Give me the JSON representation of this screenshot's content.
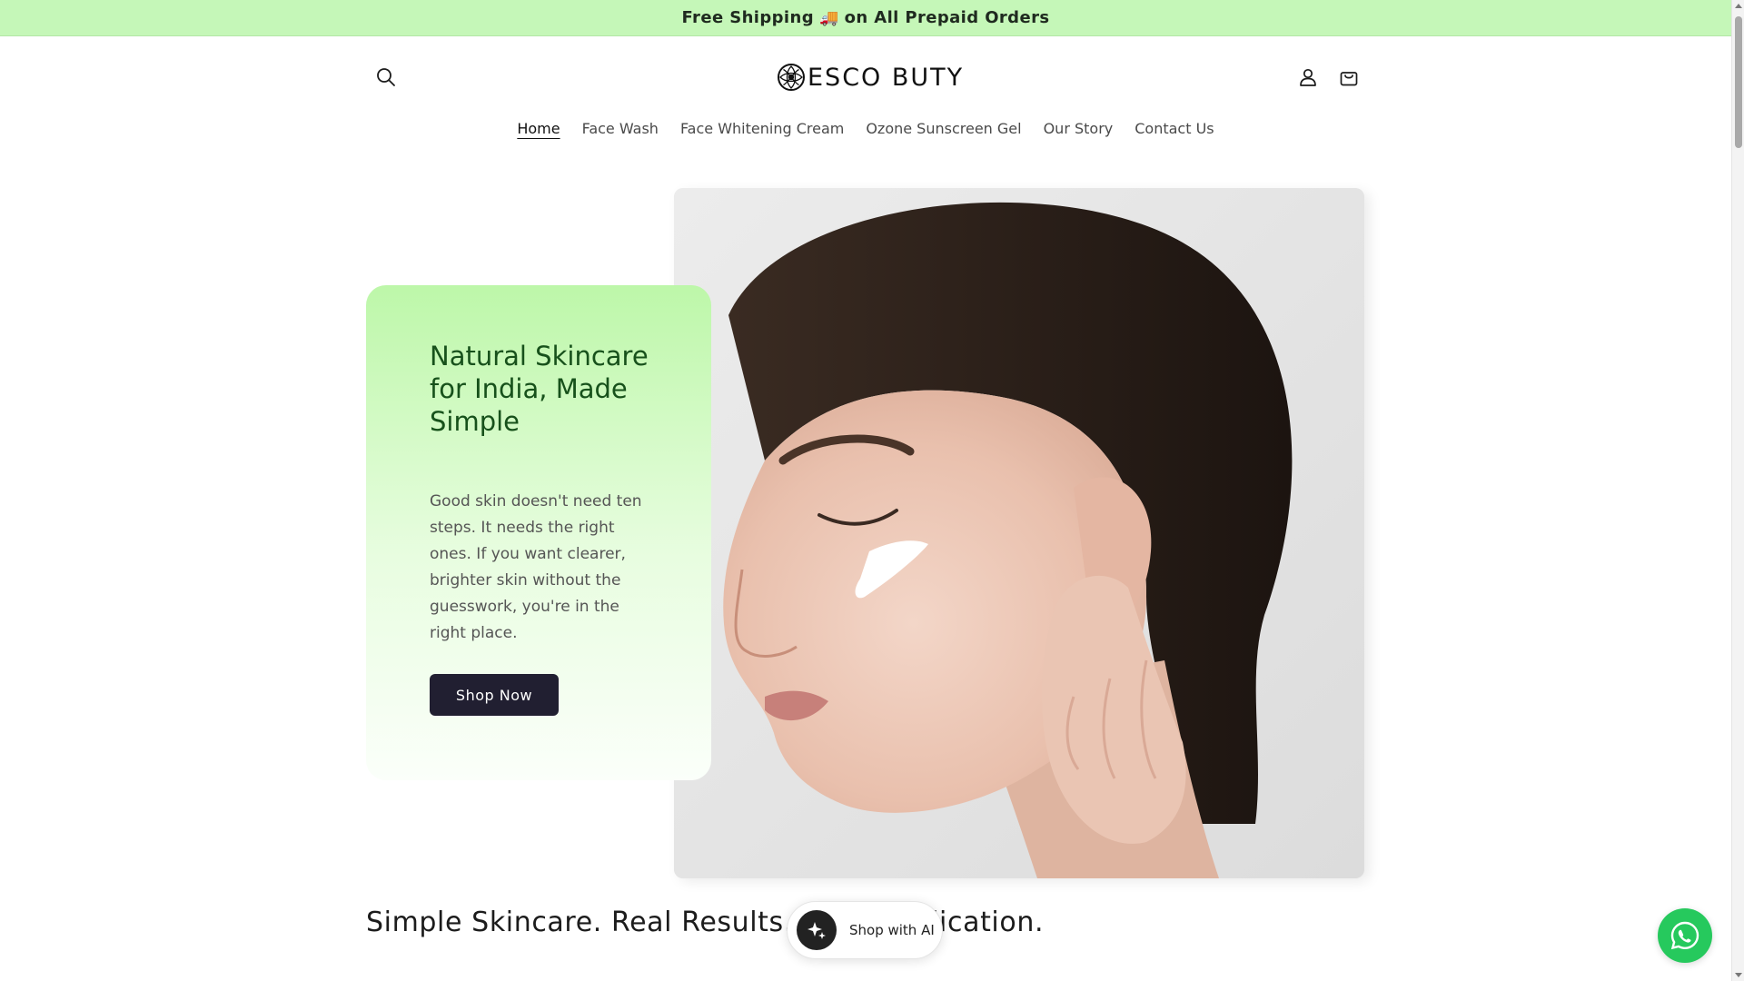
{
  "announcement": {
    "text_before": "Free Shipping",
    "truck_icon": "🚚",
    "text_after": "on All Prepaid Orders",
    "background_color": "#c5f7b8"
  },
  "header": {
    "logo_text": "ESCO BUTY",
    "icons": {
      "search": "search-icon",
      "account": "account-icon",
      "cart": "cart-icon"
    }
  },
  "nav": {
    "items": [
      {
        "label": "Home",
        "active": true
      },
      {
        "label": "Face Wash",
        "active": false
      },
      {
        "label": "Face Whitening Cream",
        "active": false
      },
      {
        "label": "Ozone Sunscreen Gel",
        "active": false
      },
      {
        "label": "Our Story",
        "active": false
      },
      {
        "label": "Contact Us",
        "active": false
      }
    ]
  },
  "hero": {
    "heading": "Natural Skincare for India, Made Simple",
    "body": "Good skin doesn't need ten steps. It needs the right ones. If you want clearer, brighter skin without the guesswork, you're in the right place.",
    "button_label": "Shop Now",
    "button_color": "#211f31",
    "heading_color": "#17511b",
    "image_alt": "woman-applying-face-cream"
  },
  "section": {
    "tagline": "Simple Skincare. Real Results. No Complication."
  },
  "widgets": {
    "ai_button_label": "Shop with AI",
    "ai_icon": "sparkle-icon",
    "whatsapp_icon": "whatsapp-icon",
    "whatsapp_color": "#26c95d"
  }
}
